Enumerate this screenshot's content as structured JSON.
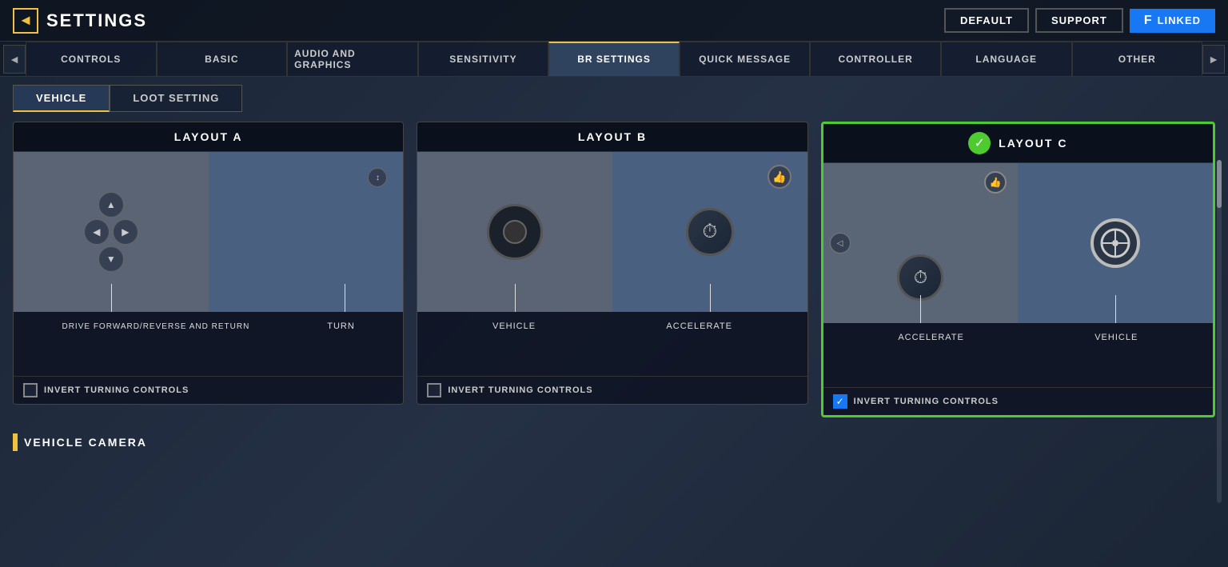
{
  "app": {
    "title": "SETTINGS",
    "back_label": "◄"
  },
  "top_bar": {
    "default_label": "DEFAULT",
    "support_label": "SUPPORT",
    "linked_label": "LINKED",
    "fb_icon": "f"
  },
  "nav_tabs": {
    "left_arrow": "◄",
    "right_arrow": "►",
    "items": [
      {
        "id": "controls",
        "label": "CONTROLS",
        "active": false
      },
      {
        "id": "basic",
        "label": "BASIC",
        "active": false
      },
      {
        "id": "audio-graphics",
        "label": "AUDIO AND GRAPHICS",
        "active": false
      },
      {
        "id": "sensitivity",
        "label": "SENSITIVITY",
        "active": false
      },
      {
        "id": "br-settings",
        "label": "BR SETTINGS",
        "active": true
      },
      {
        "id": "quick-message",
        "label": "QUICK MESSAGE",
        "active": false
      },
      {
        "id": "controller",
        "label": "CONTROLLER",
        "active": false
      },
      {
        "id": "language",
        "label": "LANGUAGE",
        "active": false
      },
      {
        "id": "other",
        "label": "OTHER",
        "active": false
      }
    ]
  },
  "sub_tabs": {
    "items": [
      {
        "id": "vehicle",
        "label": "VEHICLE",
        "active": true
      },
      {
        "id": "loot-setting",
        "label": "LOOT SETTING",
        "active": false
      }
    ]
  },
  "layouts": {
    "layout_a": {
      "title": "LAYOUT A",
      "selected": false,
      "drive_label": "DRIVE FORWARD/REVERSE AND RETURN",
      "turn_label": "TURN",
      "invert_label": "INVERT TURNING CONTROLS",
      "invert_checked": false
    },
    "layout_b": {
      "title": "LAYOUT B",
      "selected": false,
      "vehicle_label": "VEHICLE",
      "accelerate_label": "ACCELERATE",
      "invert_label": "INVERT TURNING CONTROLS",
      "invert_checked": false
    },
    "layout_c": {
      "title": "LAYOUT C",
      "selected": true,
      "accelerate_label": "ACCELERATE",
      "vehicle_label": "VEHICLE",
      "invert_label": "INVERT TURNING CONTROLS",
      "invert_checked": true
    }
  },
  "vehicle_camera": {
    "title": "VEHICLE CAMERA"
  },
  "icons": {
    "up_arrow": "▲",
    "down_arrow": "▼",
    "left_arrow": "◀",
    "right_arrow": "▶",
    "checkmark": "✓",
    "thumb_up": "👍",
    "steering": "🔘",
    "speedometer": "⏱"
  }
}
